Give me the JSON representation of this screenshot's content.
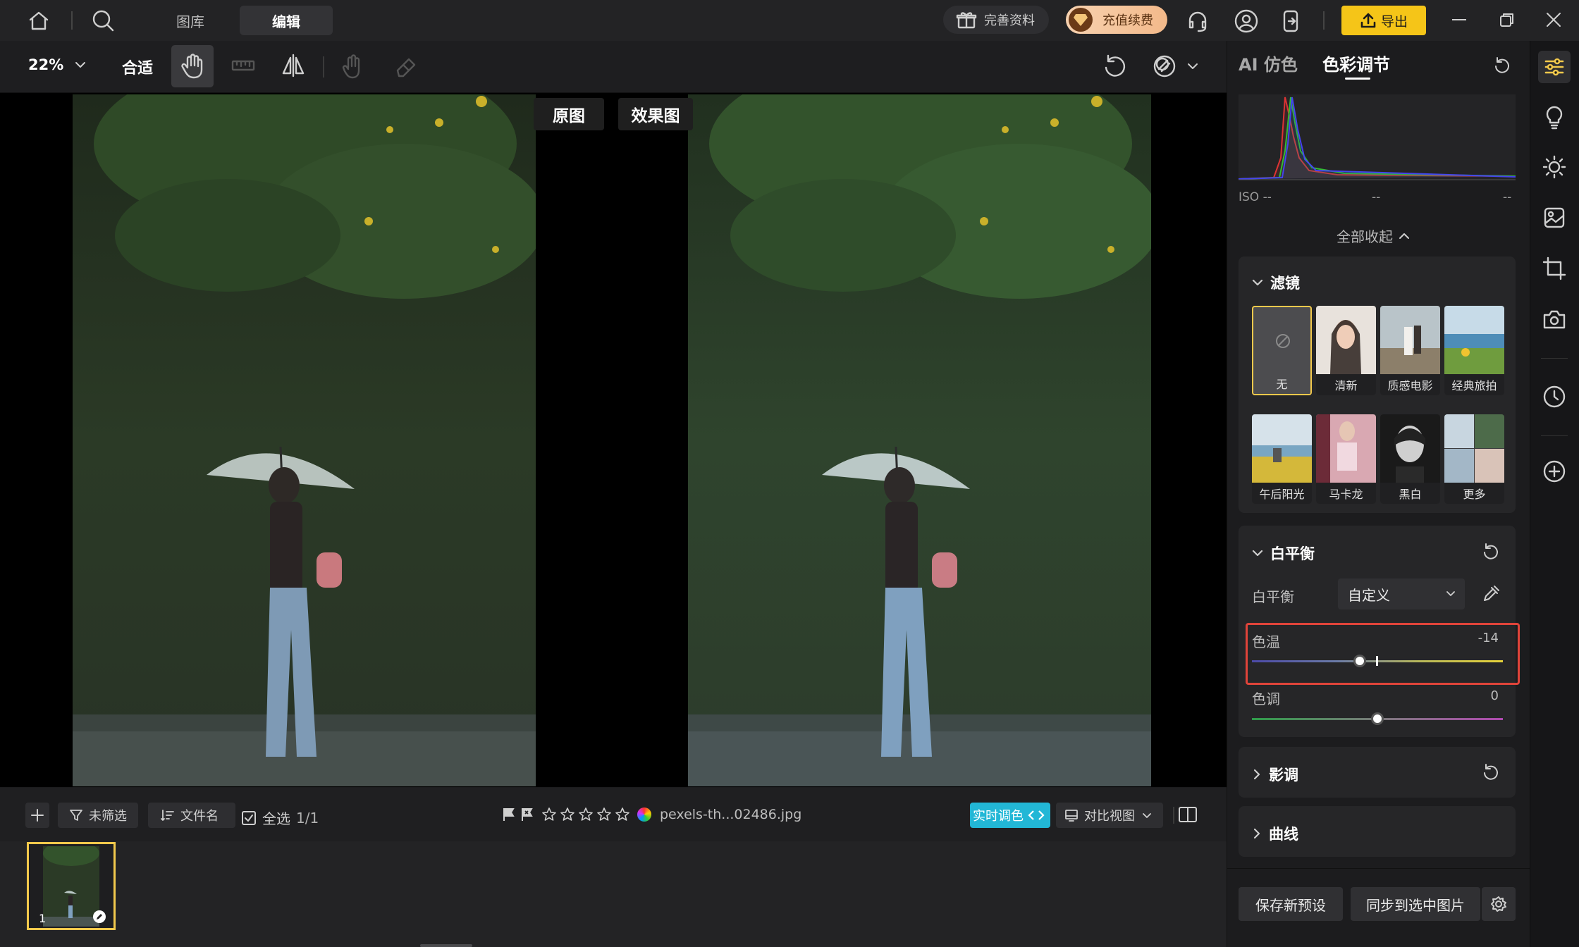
{
  "topbar": {
    "tabs": [
      "图库",
      "编辑"
    ],
    "active_tab": "编辑",
    "profile_pill": "完善资料",
    "recharge_pill": "充值续费",
    "export_button": "导出"
  },
  "toolbar": {
    "zoom": "22%",
    "fit": "合适"
  },
  "canvas": {
    "label_original": "原图",
    "label_effect": "效果图"
  },
  "bottombar": {
    "filter": "未筛选",
    "sort": "文件名",
    "select_all": "全选",
    "count": "1/1",
    "filename": "pexels-th...02486.jpg",
    "realtime": "实时调色",
    "compare_view": "对比视图",
    "rating_max": 5
  },
  "filmstrip": {
    "index": "1"
  },
  "panel": {
    "tabs": [
      "AI 仿色",
      "色彩调节"
    ],
    "active_tab": "色彩调节",
    "histogram": {
      "iso": "ISO --",
      "mid": "--",
      "right": "--"
    },
    "collapse_all": "全部收起",
    "filters": {
      "title": "滤镜",
      "items": [
        "无",
        "清新",
        "质感电影",
        "经典旅拍",
        "午后阳光",
        "马卡龙",
        "黑白",
        "更多"
      ],
      "selected": "无"
    },
    "white_balance": {
      "title": "白平衡",
      "wb_label": "白平衡",
      "wb_value": "自定义",
      "temp_label": "色温",
      "temp_value": "-14",
      "temp_level": -14,
      "tint_label": "色调",
      "tint_value": "0",
      "tint_level": 0
    },
    "tone": {
      "title": "影调"
    },
    "curve": {
      "title": "曲线"
    },
    "save_preset": "保存新预设",
    "sync": "同步到选中图片"
  },
  "colors": {
    "accent": "#f2c94c",
    "cyan": "#22b7d6",
    "highlight_border": "#e0443a",
    "export_bg": "#f5c518"
  }
}
